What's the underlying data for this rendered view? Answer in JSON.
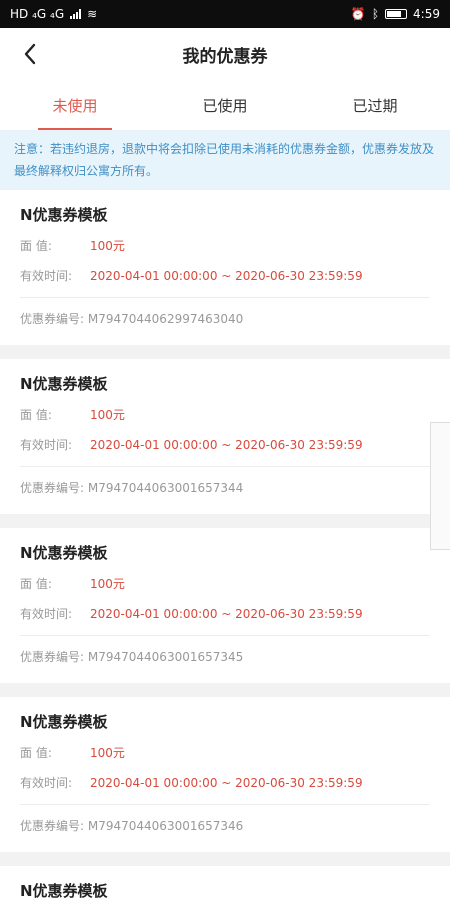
{
  "status_bar": {
    "left": "HD ₄G ₄G",
    "time": "4:59"
  },
  "header": {
    "title": "我的优惠券"
  },
  "tabs": [
    {
      "label": "未使用",
      "active": true
    },
    {
      "label": "已使用",
      "active": false
    },
    {
      "label": "已过期",
      "active": false
    }
  ],
  "notice": "注意：若违约退房，退款中将会扣除已使用未消耗的优惠券金额，优惠券发放及最终解释权归公寓方所有。",
  "labels": {
    "face_value": "面 值:",
    "valid_time": "有效时间:",
    "code": "优惠券编号:"
  },
  "coupons": [
    {
      "title": "N优惠券模板",
      "value": "100元",
      "valid": "2020-04-01 00:00:00 ~ 2020-06-30 23:59:59",
      "code": "M7947044062997463040"
    },
    {
      "title": "N优惠券模板",
      "value": "100元",
      "valid": "2020-04-01 00:00:00 ~ 2020-06-30 23:59:59",
      "code": "M7947044063001657344"
    },
    {
      "title": "N优惠券模板",
      "value": "100元",
      "valid": "2020-04-01 00:00:00 ~ 2020-06-30 23:59:59",
      "code": "M7947044063001657345"
    },
    {
      "title": "N优惠券模板",
      "value": "100元",
      "valid": "2020-04-01 00:00:00 ~ 2020-06-30 23:59:59",
      "code": "M7947044063001657346"
    },
    {
      "title": "N优惠券模板"
    }
  ],
  "colors": {
    "accent": "#e05a4e",
    "notice_bg": "#e8f4fb",
    "notice_text": "#3f8fc6"
  }
}
